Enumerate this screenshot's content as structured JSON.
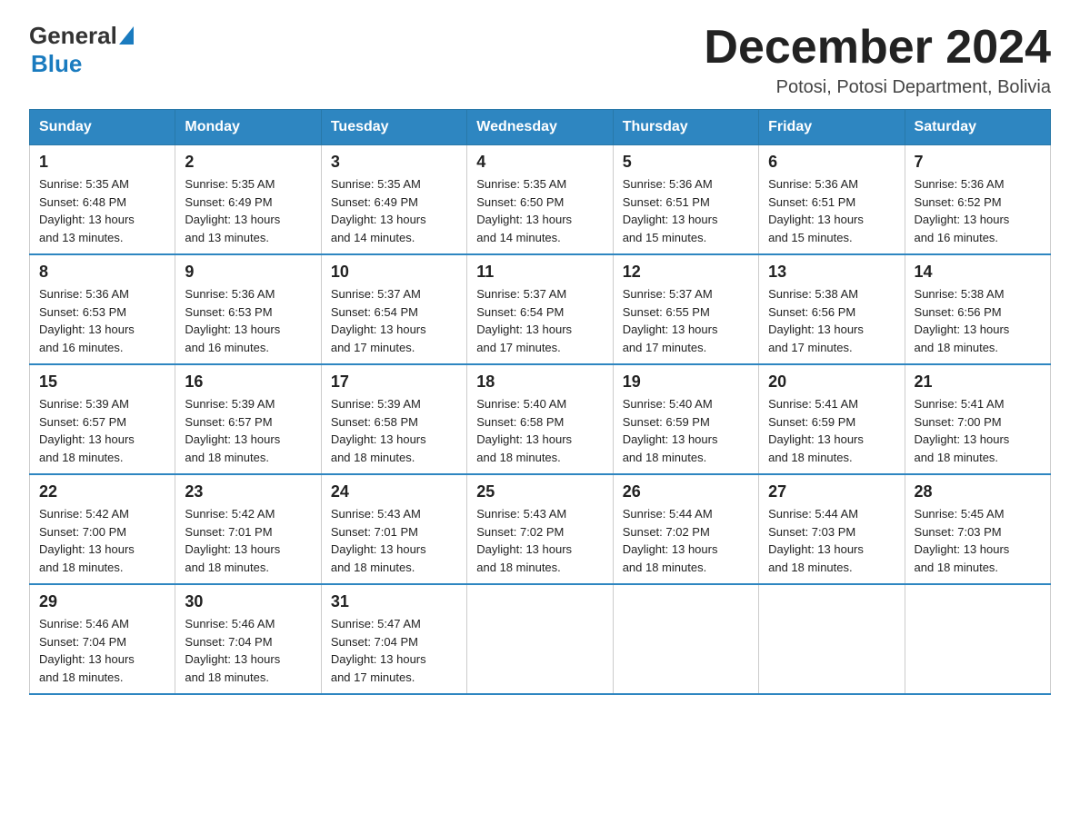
{
  "header": {
    "logo": {
      "general": "General",
      "blue": "Blue"
    },
    "title": "December 2024",
    "location": "Potosi, Potosi Department, Bolivia"
  },
  "days_of_week": [
    "Sunday",
    "Monday",
    "Tuesday",
    "Wednesday",
    "Thursday",
    "Friday",
    "Saturday"
  ],
  "weeks": [
    [
      {
        "day": "1",
        "sunrise": "5:35 AM",
        "sunset": "6:48 PM",
        "daylight": "13 hours and 13 minutes."
      },
      {
        "day": "2",
        "sunrise": "5:35 AM",
        "sunset": "6:49 PM",
        "daylight": "13 hours and 13 minutes."
      },
      {
        "day": "3",
        "sunrise": "5:35 AM",
        "sunset": "6:49 PM",
        "daylight": "13 hours and 14 minutes."
      },
      {
        "day": "4",
        "sunrise": "5:35 AM",
        "sunset": "6:50 PM",
        "daylight": "13 hours and 14 minutes."
      },
      {
        "day": "5",
        "sunrise": "5:36 AM",
        "sunset": "6:51 PM",
        "daylight": "13 hours and 15 minutes."
      },
      {
        "day": "6",
        "sunrise": "5:36 AM",
        "sunset": "6:51 PM",
        "daylight": "13 hours and 15 minutes."
      },
      {
        "day": "7",
        "sunrise": "5:36 AM",
        "sunset": "6:52 PM",
        "daylight": "13 hours and 16 minutes."
      }
    ],
    [
      {
        "day": "8",
        "sunrise": "5:36 AM",
        "sunset": "6:53 PM",
        "daylight": "13 hours and 16 minutes."
      },
      {
        "day": "9",
        "sunrise": "5:36 AM",
        "sunset": "6:53 PM",
        "daylight": "13 hours and 16 minutes."
      },
      {
        "day": "10",
        "sunrise": "5:37 AM",
        "sunset": "6:54 PM",
        "daylight": "13 hours and 17 minutes."
      },
      {
        "day": "11",
        "sunrise": "5:37 AM",
        "sunset": "6:54 PM",
        "daylight": "13 hours and 17 minutes."
      },
      {
        "day": "12",
        "sunrise": "5:37 AM",
        "sunset": "6:55 PM",
        "daylight": "13 hours and 17 minutes."
      },
      {
        "day": "13",
        "sunrise": "5:38 AM",
        "sunset": "6:56 PM",
        "daylight": "13 hours and 17 minutes."
      },
      {
        "day": "14",
        "sunrise": "5:38 AM",
        "sunset": "6:56 PM",
        "daylight": "13 hours and 18 minutes."
      }
    ],
    [
      {
        "day": "15",
        "sunrise": "5:39 AM",
        "sunset": "6:57 PM",
        "daylight": "13 hours and 18 minutes."
      },
      {
        "day": "16",
        "sunrise": "5:39 AM",
        "sunset": "6:57 PM",
        "daylight": "13 hours and 18 minutes."
      },
      {
        "day": "17",
        "sunrise": "5:39 AM",
        "sunset": "6:58 PM",
        "daylight": "13 hours and 18 minutes."
      },
      {
        "day": "18",
        "sunrise": "5:40 AM",
        "sunset": "6:58 PM",
        "daylight": "13 hours and 18 minutes."
      },
      {
        "day": "19",
        "sunrise": "5:40 AM",
        "sunset": "6:59 PM",
        "daylight": "13 hours and 18 minutes."
      },
      {
        "day": "20",
        "sunrise": "5:41 AM",
        "sunset": "6:59 PM",
        "daylight": "13 hours and 18 minutes."
      },
      {
        "day": "21",
        "sunrise": "5:41 AM",
        "sunset": "7:00 PM",
        "daylight": "13 hours and 18 minutes."
      }
    ],
    [
      {
        "day": "22",
        "sunrise": "5:42 AM",
        "sunset": "7:00 PM",
        "daylight": "13 hours and 18 minutes."
      },
      {
        "day": "23",
        "sunrise": "5:42 AM",
        "sunset": "7:01 PM",
        "daylight": "13 hours and 18 minutes."
      },
      {
        "day": "24",
        "sunrise": "5:43 AM",
        "sunset": "7:01 PM",
        "daylight": "13 hours and 18 minutes."
      },
      {
        "day": "25",
        "sunrise": "5:43 AM",
        "sunset": "7:02 PM",
        "daylight": "13 hours and 18 minutes."
      },
      {
        "day": "26",
        "sunrise": "5:44 AM",
        "sunset": "7:02 PM",
        "daylight": "13 hours and 18 minutes."
      },
      {
        "day": "27",
        "sunrise": "5:44 AM",
        "sunset": "7:03 PM",
        "daylight": "13 hours and 18 minutes."
      },
      {
        "day": "28",
        "sunrise": "5:45 AM",
        "sunset": "7:03 PM",
        "daylight": "13 hours and 18 minutes."
      }
    ],
    [
      {
        "day": "29",
        "sunrise": "5:46 AM",
        "sunset": "7:04 PM",
        "daylight": "13 hours and 18 minutes."
      },
      {
        "day": "30",
        "sunrise": "5:46 AM",
        "sunset": "7:04 PM",
        "daylight": "13 hours and 18 minutes."
      },
      {
        "day": "31",
        "sunrise": "5:47 AM",
        "sunset": "7:04 PM",
        "daylight": "13 hours and 17 minutes."
      },
      null,
      null,
      null,
      null
    ]
  ],
  "labels": {
    "sunrise": "Sunrise:",
    "sunset": "Sunset:",
    "daylight": "Daylight:"
  }
}
